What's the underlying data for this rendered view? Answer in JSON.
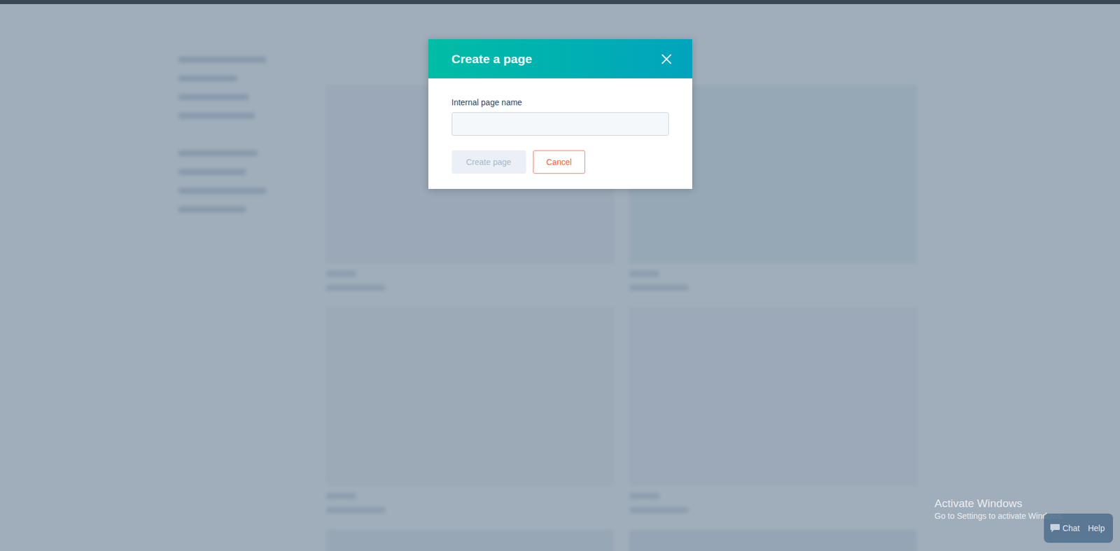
{
  "modal": {
    "title": "Create a page",
    "field": {
      "label": "Internal page name",
      "value": ""
    },
    "buttons": [
      {
        "label": "Create page",
        "kind": "primary",
        "disabled": true
      },
      {
        "label": "Cancel",
        "kind": "secondary",
        "disabled": false
      }
    ]
  },
  "watermark": {
    "title": "Activate Windows",
    "subtitle": "Go to Settings to activate Windows."
  },
  "help_widget": {
    "items": [
      "Chat",
      "Help"
    ]
  }
}
